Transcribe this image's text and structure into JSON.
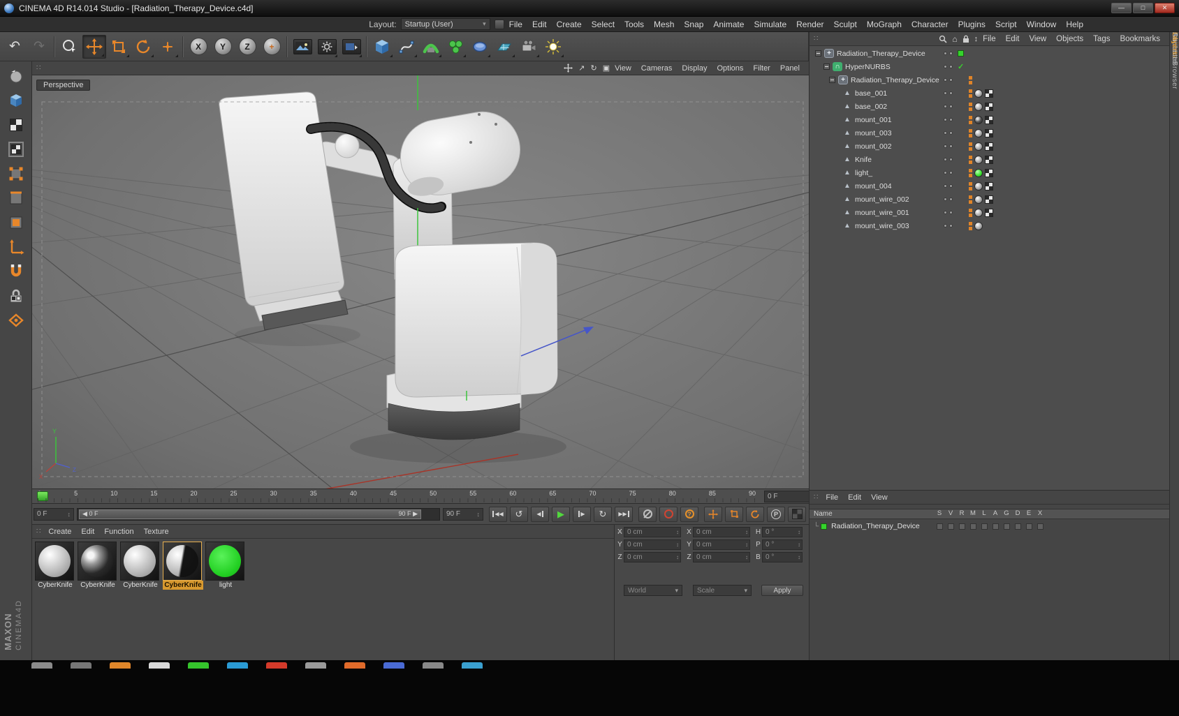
{
  "window": {
    "title": "CINEMA 4D R14.014 Studio - [Radiation_Therapy_Device.c4d]",
    "minimize": "—",
    "maximize": "□",
    "close": "✕"
  },
  "menubar": {
    "items": [
      "File",
      "Edit",
      "Create",
      "Select",
      "Tools",
      "Mesh",
      "Snap",
      "Animate",
      "Simulate",
      "Render",
      "Sculpt",
      "MoGraph",
      "Character",
      "Plugins",
      "Script",
      "Window",
      "Help"
    ],
    "layout_label": "Layout:",
    "layout_value": "Startup (User)"
  },
  "toolbar": {
    "undo_glyph": "↶",
    "redo_glyph": "↷",
    "rotate_glyph": "↻",
    "axis_locks": [
      "X",
      "Y",
      "Z"
    ],
    "coord_glyph": "+"
  },
  "viewport": {
    "menu": [
      "View",
      "Cameras",
      "Display",
      "Options",
      "Filter",
      "Panel"
    ],
    "camera_label": "Perspective",
    "corner": {
      "rotate": "↻",
      "zoom": "↗",
      "toggle": "▣"
    },
    "axis_labels": {
      "x": "X",
      "y": "Y",
      "z": "Z"
    }
  },
  "timeline": {
    "ticks": [
      "0",
      "5",
      "10",
      "15",
      "20",
      "25",
      "30",
      "35",
      "40",
      "45",
      "50",
      "55",
      "60",
      "65",
      "70",
      "75",
      "80",
      "85",
      "90"
    ],
    "frame_field": "0 F",
    "start_field": "0 F",
    "range_start_label": "0 F",
    "range_end_label": "90 F",
    "end_field": "90 F",
    "transport": {
      "goto_start": "◀◀",
      "loop": "↺",
      "prev": "◀",
      "play": "▶",
      "next": "▶",
      "cycle": "↻",
      "goto_end": "▶▶"
    },
    "autokey_glyph": "?",
    "param_glyph": "P"
  },
  "materials": {
    "menu": [
      "Create",
      "Edit",
      "Function",
      "Texture"
    ],
    "items": [
      {
        "label": "CyberKnife",
        "variant": "m-light",
        "state": ""
      },
      {
        "label": "CyberKnife",
        "variant": "m-dark",
        "state": ""
      },
      {
        "label": "CyberKnife",
        "variant": "m-light",
        "state": ""
      },
      {
        "label": "CyberKnife",
        "variant": "m-half",
        "state": "selected"
      },
      {
        "label": "light",
        "variant": "m-green",
        "state": ""
      }
    ]
  },
  "coordinates": {
    "headers": [
      "--",
      "--",
      "--"
    ],
    "rows": [
      {
        "l1": "X",
        "v1": "0 cm",
        "l2": "X",
        "v2": "0 cm",
        "l3": "H",
        "v3": "0 °"
      },
      {
        "l1": "Y",
        "v1": "0 cm",
        "l2": "Y",
        "v2": "0 cm",
        "l3": "P",
        "v3": "0 °"
      },
      {
        "l1": "Z",
        "v1": "0 cm",
        "l2": "Z",
        "v2": "0 cm",
        "l3": "B",
        "v3": "0 °"
      }
    ],
    "transform_space": "World",
    "size_mode": "Scale",
    "apply_label": "Apply"
  },
  "object_manager": {
    "menu": [
      "File",
      "Edit",
      "View",
      "Objects",
      "Tags",
      "Bookmarks"
    ],
    "home_glyph": "⌂",
    "tree": [
      {
        "label": "Radiation_Therapy_Device",
        "indent": "d0",
        "icon": "obj-null",
        "icon_glyph": "+",
        "expander": true,
        "dots": true,
        "extra": "extra-green"
      },
      {
        "label": "HyperNURBS",
        "indent": "d1",
        "icon": "obj-hn",
        "icon_glyph": "∩",
        "expander": true,
        "dots": true,
        "extra": "extra-check",
        "extra_glyph": "✓"
      },
      {
        "label": "Radiation_Therapy_Device",
        "indent": "d2",
        "icon": "obj-null",
        "icon_glyph": "+",
        "expander": true,
        "dots": true,
        "tag_sel": true
      },
      {
        "label": "base_001",
        "indent": "d3",
        "icon": "obj-poly",
        "icon_glyph": "▲",
        "dots": true,
        "tag_sel": true,
        "tag_mat": "mat-gray",
        "tag_uvw": true
      },
      {
        "label": "base_002",
        "indent": "d3",
        "icon": "obj-poly",
        "icon_glyph": "▲",
        "dots": true,
        "tag_sel": true,
        "tag_mat": "mat-gray",
        "tag_uvw": true
      },
      {
        "label": "mount_001",
        "indent": "d3",
        "icon": "obj-poly",
        "icon_glyph": "▲",
        "dots": true,
        "tag_sel": true,
        "tag_mat": "mat-dark",
        "tag_uvw": true
      },
      {
        "label": "mount_003",
        "indent": "d3",
        "icon": "obj-poly",
        "icon_glyph": "▲",
        "dots": true,
        "tag_sel": true,
        "tag_mat": "mat-gray",
        "tag_uvw": true
      },
      {
        "label": "mount_002",
        "indent": "d3",
        "icon": "obj-poly",
        "icon_glyph": "▲",
        "dots": true,
        "tag_sel": true,
        "tag_mat": "mat-gray",
        "tag_uvw": true
      },
      {
        "label": "Knife",
        "indent": "d3",
        "icon": "obj-poly",
        "icon_glyph": "▲",
        "dots": true,
        "tag_sel": true,
        "tag_mat": "mat-gray",
        "tag_uvw": true
      },
      {
        "label": "light_",
        "indent": "d3",
        "icon": "obj-poly",
        "icon_glyph": "▲",
        "dots": true,
        "tag_sel": true,
        "tag_mat": "mat-green",
        "tag_uvw": true
      },
      {
        "label": "mount_004",
        "indent": "d3",
        "icon": "obj-poly",
        "icon_glyph": "▲",
        "dots": true,
        "tag_sel": true,
        "tag_mat": "mat-gray",
        "tag_uvw": true
      },
      {
        "label": "mount_wire_002",
        "indent": "d3",
        "icon": "obj-poly",
        "icon_glyph": "▲",
        "dots": true,
        "tag_sel": true,
        "tag_mat": "mat-gray",
        "tag_uvw": true
      },
      {
        "label": "mount_wire_001",
        "indent": "d3",
        "icon": "obj-poly",
        "icon_glyph": "▲",
        "dots": true,
        "tag_sel": true,
        "tag_mat": "mat-gray",
        "tag_uvw": true
      },
      {
        "label": "mount_wire_003",
        "indent": "d3",
        "icon": "obj-poly",
        "icon_glyph": "▲",
        "dots": true,
        "tag_sel": true,
        "tag_mat": "mat-gray"
      }
    ]
  },
  "layers_panel": {
    "menu": [
      "File",
      "Edit",
      "View"
    ],
    "name_header": "Name",
    "columns": [
      "S",
      "V",
      "R",
      "M",
      "L",
      "A",
      "G",
      "D",
      "E",
      "X"
    ],
    "elbow": "└",
    "rows": [
      {
        "label": "Radiation_Therapy_Device"
      }
    ]
  },
  "side_tabs": [
    {
      "label": "Objects",
      "state": "active"
    },
    {
      "label": "Content Browser",
      "state": ""
    },
    {
      "label": "Structure",
      "state": ""
    },
    {
      "label": "Attributes",
      "state": ""
    },
    {
      "label": "Layers",
      "state": "active"
    }
  ],
  "branding": {
    "maxon": "MAXON",
    "cinema": "CINEMA4D"
  }
}
